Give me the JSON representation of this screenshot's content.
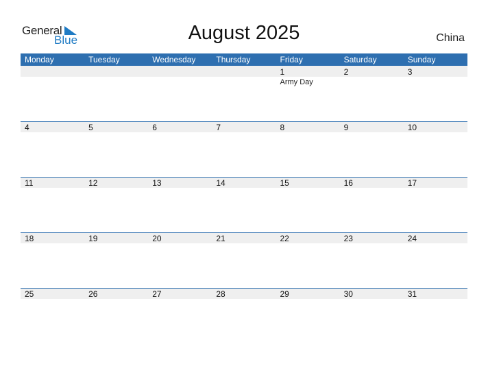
{
  "logo": {
    "word1": "General",
    "word2": "Blue"
  },
  "title": "August 2025",
  "country": "China",
  "weekdays": [
    "Monday",
    "Tuesday",
    "Wednesday",
    "Thursday",
    "Friday",
    "Saturday",
    "Sunday"
  ],
  "weeks": [
    [
      {
        "day": ""
      },
      {
        "day": ""
      },
      {
        "day": ""
      },
      {
        "day": ""
      },
      {
        "day": "1",
        "event": "Army Day"
      },
      {
        "day": "2"
      },
      {
        "day": "3"
      }
    ],
    [
      {
        "day": "4"
      },
      {
        "day": "5"
      },
      {
        "day": "6"
      },
      {
        "day": "7"
      },
      {
        "day": "8"
      },
      {
        "day": "9"
      },
      {
        "day": "10"
      }
    ],
    [
      {
        "day": "11"
      },
      {
        "day": "12"
      },
      {
        "day": "13"
      },
      {
        "day": "14"
      },
      {
        "day": "15"
      },
      {
        "day": "16"
      },
      {
        "day": "17"
      }
    ],
    [
      {
        "day": "18"
      },
      {
        "day": "19"
      },
      {
        "day": "20"
      },
      {
        "day": "21"
      },
      {
        "day": "22"
      },
      {
        "day": "23"
      },
      {
        "day": "24"
      }
    ],
    [
      {
        "day": "25"
      },
      {
        "day": "26"
      },
      {
        "day": "27"
      },
      {
        "day": "28"
      },
      {
        "day": "29"
      },
      {
        "day": "30"
      },
      {
        "day": "31"
      }
    ]
  ],
  "colors": {
    "accent": "#2e6fb0",
    "logo_blue": "#1f7bc4",
    "strip": "#efefef"
  }
}
